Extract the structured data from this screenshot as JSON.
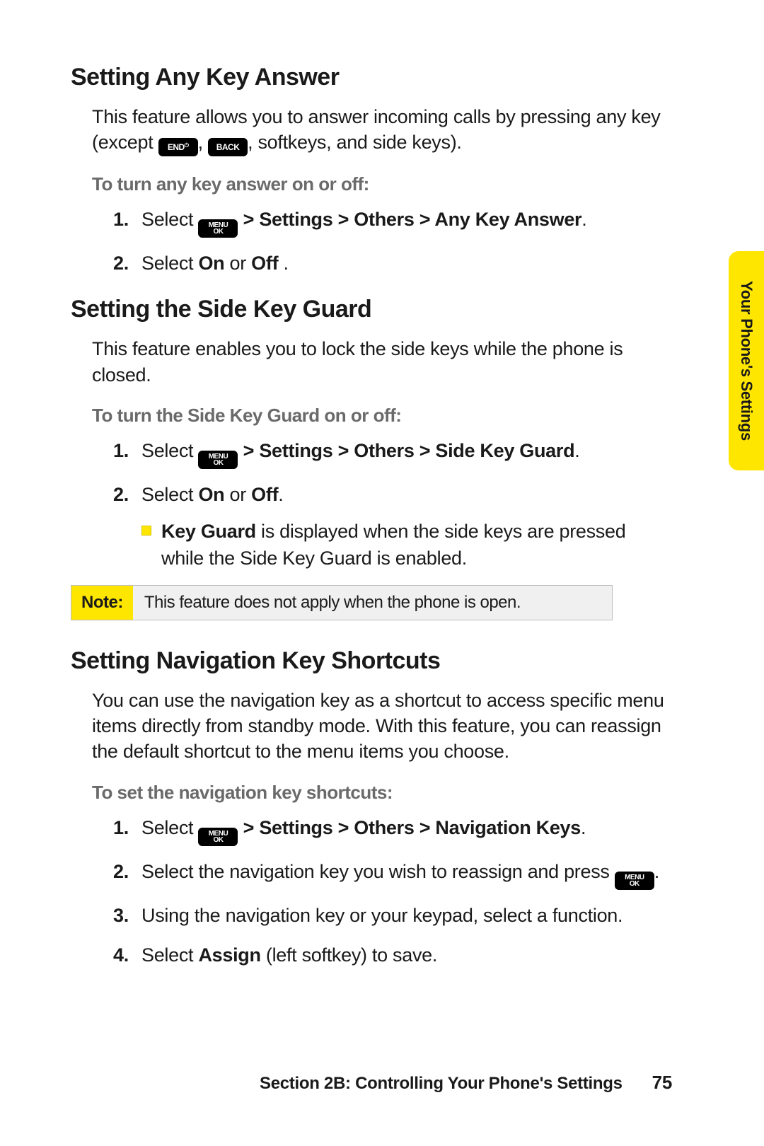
{
  "side_tab": "Your Phone's Settings",
  "sectionA": {
    "title": "Setting Any Key Answer",
    "intro_a": "This feature allows you to answer incoming calls by pressing any key (except ",
    "intro_b": ", ",
    "intro_c": ", softkeys, and side keys).",
    "subhead": "To turn any key answer on or off:",
    "step1_a": "Select ",
    "step1_b": " > Settings > Others > Any Key Answer",
    "step1_c": ".",
    "step2_a": "Select ",
    "step2_b": "On",
    "step2_c": " or ",
    "step2_d": "Off",
    "step2_e": " ."
  },
  "sectionB": {
    "title": "Setting the Side Key Guard",
    "intro": "This feature enables you to lock the side keys while the phone is closed.",
    "subhead": "To turn the Side Key Guard on or off:",
    "step1_a": "Select ",
    "step1_b": " > Settings > Others > Side Key Guard",
    "step1_c": ".",
    "step2_a": "Select ",
    "step2_b": "On",
    "step2_c": " or ",
    "step2_d": "Off",
    "step2_e": ".",
    "bullet_a": "Key Guard",
    "bullet_b": " is displayed when the side keys are pressed while the Side Key Guard is enabled."
  },
  "note": {
    "label": "Note:",
    "text": "This feature does not apply when the phone is open."
  },
  "sectionC": {
    "title": "Setting Navigation Key Shortcuts",
    "intro": "You can use the navigation key as a shortcut to access specific menu items directly from standby mode. With this feature, you can reassign the default shortcut to the menu items you choose.",
    "subhead": "To set the navigation key shortcuts:",
    "step1_a": "Select ",
    "step1_b": " > Settings > Others > Navigation Keys",
    "step1_c": ".",
    "step2_a": "Select the navigation key you wish to reassign and press ",
    "step2_b": ".",
    "step3": "Using the navigation key or your keypad, select a function.",
    "step4_a": "Select ",
    "step4_b": "Assign",
    "step4_c": " (left softkey) to save."
  },
  "footer": {
    "text": "Section 2B: Controlling Your Phone's Settings",
    "page": "75"
  },
  "keys": {
    "menu": "MENU\nOK",
    "end": "END",
    "back": "BACK"
  }
}
